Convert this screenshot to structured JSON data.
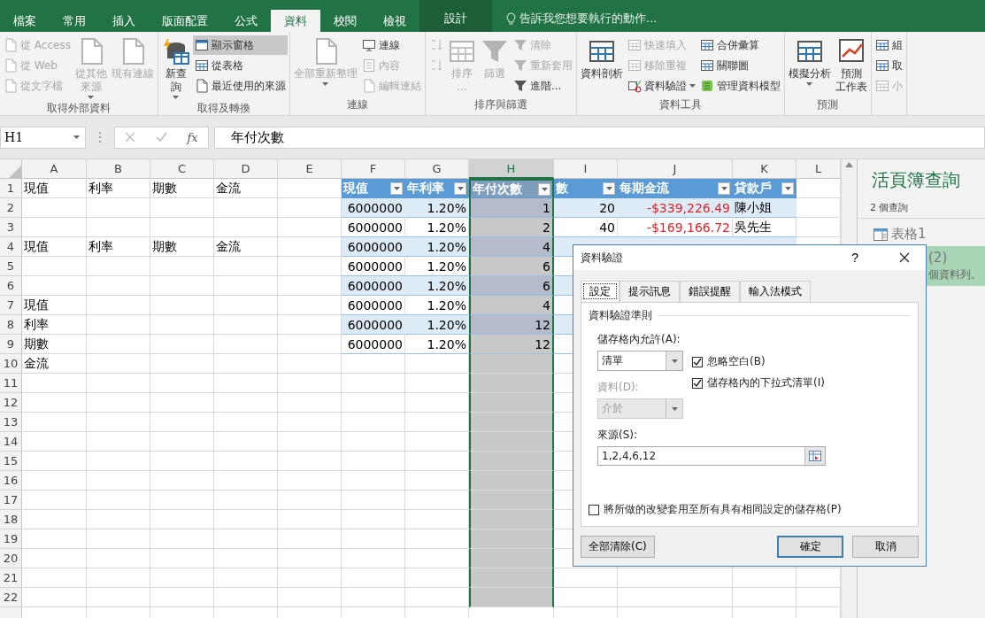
{
  "tabs": [
    {
      "label": "檔案",
      "kind": "file",
      "selected": false
    },
    {
      "label": "常用",
      "kind": "normal",
      "selected": false
    },
    {
      "label": "插入",
      "kind": "normal",
      "selected": false
    },
    {
      "label": "版面配置",
      "kind": "normal",
      "selected": false
    },
    {
      "label": "公式",
      "kind": "normal",
      "selected": false
    },
    {
      "label": "資料",
      "kind": "normal",
      "selected": true
    },
    {
      "label": "校閱",
      "kind": "normal",
      "selected": false
    },
    {
      "label": "檢視",
      "kind": "normal",
      "selected": false
    },
    {
      "label": "設計",
      "kind": "contextual",
      "selected": false
    }
  ],
  "tell_me": {
    "placeholder": "告訴我您想要執行的動作..."
  },
  "ribbon": [
    {
      "label": "取得外部資料",
      "columns": [
        {
          "kind": "stack",
          "items": [
            {
              "label": "從 Access",
              "disabled": true,
              "on": false
            },
            {
              "label": "從 Web",
              "disabled": true,
              "on": false
            },
            {
              "label": "從文字檔",
              "disabled": true,
              "on": false
            }
          ]
        },
        {
          "kind": "large",
          "lines": [
            "從其他",
            "來源"
          ],
          "disabled": true,
          "dropdown": true
        },
        {
          "kind": "large",
          "lines": [
            "現有連線"
          ],
          "disabled": true
        }
      ]
    },
    {
      "label": "取得及轉換",
      "columns": [
        {
          "kind": "large",
          "lines": [
            "新查",
            "詢"
          ],
          "disabled": false,
          "dropdown": true
        },
        {
          "kind": "stack",
          "items": [
            {
              "label": "顯示窗格",
              "disabled": false,
              "on": true
            },
            {
              "label": "從表格",
              "disabled": false,
              "on": false
            },
            {
              "label": "最近使用的來源",
              "disabled": false,
              "on": false
            }
          ]
        }
      ]
    },
    {
      "label": "連線",
      "columns": [
        {
          "kind": "large",
          "lines": [
            "全部重新整理"
          ],
          "disabled": true,
          "dropdown": true
        },
        {
          "kind": "stack",
          "items": [
            {
              "label": "連線",
              "disabled": false,
              "on": false
            },
            {
              "label": "內容",
              "disabled": true,
              "on": false
            },
            {
              "label": "編輯連結",
              "disabled": true,
              "on": false
            }
          ]
        }
      ]
    },
    {
      "label": "排序與篩選",
      "columns": [
        {
          "kind": "stack",
          "items": [
            {
              "disabled": true,
              "on": false
            },
            {
              "disabled": true,
              "on": false
            }
          ]
        },
        {
          "kind": "large",
          "lines": [
            "排序",
            "..."
          ],
          "disabled": true
        },
        {
          "kind": "large",
          "lines": [
            "篩選"
          ],
          "disabled": true
        },
        {
          "kind": "stack",
          "items": [
            {
              "label": "清除",
              "disabled": true,
              "on": false
            },
            {
              "label": "重新套用",
              "disabled": true,
              "on": false
            },
            {
              "label": "進階...",
              "disabled": false,
              "on": false
            }
          ]
        }
      ]
    },
    {
      "label": "資料工具",
      "columns": [
        {
          "kind": "large",
          "lines": [
            "資料剖析"
          ],
          "disabled": false
        },
        {
          "kind": "stack",
          "items": [
            {
              "label": "快速填入",
              "disabled": true,
              "on": false
            },
            {
              "label": "移除重複",
              "disabled": true,
              "on": false
            },
            {
              "label": "資料驗證",
              "disabled": false,
              "on": false,
              "dropdown": true
            }
          ]
        },
        {
          "kind": "stack",
          "items": [
            {
              "label": "合併彙算",
              "disabled": false,
              "on": false
            },
            {
              "label": "關聯圖",
              "disabled": false,
              "on": false
            },
            {
              "label": "管理資料模型",
              "disabled": false,
              "on": false
            }
          ]
        }
      ]
    },
    {
      "label": "預測",
      "columns": [
        {
          "kind": "large",
          "lines": [
            "模擬分析"
          ],
          "disabled": false,
          "dropdown": true
        },
        {
          "kind": "large",
          "lines": [
            "預測",
            "工作表"
          ],
          "disabled": false
        }
      ]
    },
    {
      "columns": [
        {
          "kind": "stack",
          "items": [
            {
              "label": "組",
              "disabled": false,
              "on": false
            },
            {
              "label": "取",
              "disabled": false,
              "on": false
            },
            {
              "label": "小",
              "disabled": true,
              "on": false
            }
          ]
        }
      ]
    }
  ],
  "formula_bar": {
    "name_box": "H1",
    "insert_function": "fx",
    "formula": "年付次數"
  },
  "columns": [
    {
      "label": "A",
      "selected": false
    },
    {
      "label": "B",
      "selected": false
    },
    {
      "label": "C",
      "selected": false
    },
    {
      "label": "D",
      "selected": false
    },
    {
      "label": "E",
      "selected": false
    },
    {
      "label": "F",
      "selected": false
    },
    {
      "label": "G",
      "selected": false
    },
    {
      "label": "H",
      "selected": true
    },
    {
      "label": "I",
      "selected": false
    },
    {
      "label": "J",
      "selected": false
    },
    {
      "label": "K",
      "selected": false
    },
    {
      "label": "L",
      "selected": false
    }
  ],
  "rows": [
    {
      "number": "1",
      "cells": [
        {
          "kind": "text",
          "text": "現值"
        },
        {
          "kind": "text",
          "text": "利率"
        },
        {
          "kind": "text",
          "text": "期數"
        },
        {
          "kind": "text",
          "text": "金流"
        },
        {
          "kind": "empty"
        },
        {
          "kind": "header",
          "text": "現值"
        },
        {
          "kind": "header",
          "text": "年利率"
        },
        {
          "kind": "header",
          "text": "年付次數"
        },
        {
          "kind": "header",
          "text": "數"
        },
        {
          "kind": "header",
          "text": "每期金流"
        },
        {
          "kind": "header",
          "text": "貸款戶"
        }
      ]
    },
    {
      "number": "2",
      "cells": [
        {
          "kind": "empty"
        },
        {
          "kind": "empty"
        },
        {
          "kind": "empty"
        },
        {
          "kind": "empty"
        },
        {
          "kind": "empty"
        },
        {
          "kind": "number",
          "text": "6000000",
          "shaded": true
        },
        {
          "kind": "number",
          "text": "1.20%",
          "shaded": true
        },
        {
          "kind": "number",
          "text": "1",
          "shaded": true
        },
        {
          "kind": "number",
          "text": "20",
          "shaded": true
        },
        {
          "kind": "negative",
          "text": "-$339,226.49",
          "shaded": true
        },
        {
          "kind": "text",
          "text": "陳小姐",
          "shaded": true
        }
      ]
    },
    {
      "number": "3",
      "cells": [
        {
          "kind": "empty"
        },
        {
          "kind": "empty"
        },
        {
          "kind": "empty"
        },
        {
          "kind": "empty"
        },
        {
          "kind": "empty"
        },
        {
          "kind": "number",
          "text": "6000000",
          "shaded": false
        },
        {
          "kind": "number",
          "text": "1.20%",
          "shaded": false
        },
        {
          "kind": "number",
          "text": "2",
          "shaded": false
        },
        {
          "kind": "number",
          "text": "40",
          "shaded": false
        },
        {
          "kind": "negative",
          "text": "-$169,166.72",
          "shaded": false
        },
        {
          "kind": "text",
          "text": "吳先生",
          "shaded": false
        }
      ]
    },
    {
      "number": "4",
      "cells": [
        {
          "kind": "text",
          "text": "現值"
        },
        {
          "kind": "text",
          "text": "利率"
        },
        {
          "kind": "text",
          "text": "期數"
        },
        {
          "kind": "text",
          "text": "金流"
        },
        {
          "kind": "empty"
        },
        {
          "kind": "number",
          "text": "6000000",
          "shaded": true
        },
        {
          "kind": "number",
          "text": "1.20%",
          "shaded": true
        },
        {
          "kind": "number",
          "text": "4",
          "shaded": true
        },
        {
          "kind": "empty",
          "shaded": true
        },
        {
          "kind": "empty",
          "shaded": true
        },
        {
          "kind": "empty",
          "shaded": true
        }
      ]
    },
    {
      "number": "5",
      "cells": [
        {
          "kind": "empty"
        },
        {
          "kind": "empty"
        },
        {
          "kind": "empty"
        },
        {
          "kind": "empty"
        },
        {
          "kind": "empty"
        },
        {
          "kind": "number",
          "text": "6000000",
          "shaded": false
        },
        {
          "kind": "number",
          "text": "1.20%",
          "shaded": false
        },
        {
          "kind": "number",
          "text": "6",
          "shaded": false
        },
        {
          "kind": "empty",
          "shaded": false
        }
      ]
    },
    {
      "number": "6",
      "cells": [
        {
          "kind": "empty"
        },
        {
          "kind": "empty"
        },
        {
          "kind": "empty"
        },
        {
          "kind": "empty"
        },
        {
          "kind": "empty"
        },
        {
          "kind": "number",
          "text": "6000000",
          "shaded": true
        },
        {
          "kind": "number",
          "text": "1.20%",
          "shaded": true
        },
        {
          "kind": "number",
          "text": "6",
          "shaded": true
        },
        {
          "kind": "empty",
          "shaded": true
        }
      ]
    },
    {
      "number": "7",
      "cells": [
        {
          "kind": "text",
          "text": "現值"
        },
        {
          "kind": "empty"
        },
        {
          "kind": "empty"
        },
        {
          "kind": "empty"
        },
        {
          "kind": "empty"
        },
        {
          "kind": "number",
          "text": "6000000",
          "shaded": false
        },
        {
          "kind": "number",
          "text": "1.20%",
          "shaded": false
        },
        {
          "kind": "number",
          "text": "4",
          "shaded": false
        },
        {
          "kind": "empty",
          "shaded": false
        }
      ]
    },
    {
      "number": "8",
      "cells": [
        {
          "kind": "text",
          "text": "利率"
        },
        {
          "kind": "empty"
        },
        {
          "kind": "empty"
        },
        {
          "kind": "empty"
        },
        {
          "kind": "empty"
        },
        {
          "kind": "number",
          "text": "6000000",
          "shaded": true
        },
        {
          "kind": "number",
          "text": "1.20%",
          "shaded": true
        },
        {
          "kind": "number",
          "text": "12",
          "shaded": true
        },
        {
          "kind": "empty",
          "shaded": true
        }
      ]
    },
    {
      "number": "9",
      "cells": [
        {
          "kind": "text",
          "text": "期數"
        },
        {
          "kind": "empty"
        },
        {
          "kind": "empty"
        },
        {
          "kind": "empty"
        },
        {
          "kind": "empty"
        },
        {
          "kind": "number",
          "text": "6000000",
          "shaded": false
        },
        {
          "kind": "number",
          "text": "1.20%",
          "shaded": false
        },
        {
          "kind": "number",
          "text": "12",
          "shaded": false
        },
        {
          "kind": "empty",
          "shaded": false
        }
      ]
    },
    {
      "number": "10",
      "cells": [
        {
          "kind": "text",
          "text": "金流"
        }
      ]
    },
    {
      "number": "11",
      "cells": []
    },
    {
      "number": "12",
      "cells": []
    },
    {
      "number": "13",
      "cells": []
    },
    {
      "number": "14",
      "cells": []
    },
    {
      "number": "15",
      "cells": []
    },
    {
      "number": "16",
      "cells": []
    },
    {
      "number": "17",
      "cells": []
    },
    {
      "number": "18",
      "cells": []
    },
    {
      "number": "19",
      "cells": []
    },
    {
      "number": "20",
      "cells": []
    },
    {
      "number": "21",
      "cells": []
    },
    {
      "number": "22",
      "cells": []
    }
  ],
  "query_pane": {
    "title": "活頁簿查詢",
    "count": "2 個查詢",
    "items": [
      {
        "kind": "query",
        "name": "表格1",
        "selected": false
      },
      {
        "kind": "query_partial",
        "name": "(2)",
        "detail": "個資料列。",
        "selected": true
      }
    ]
  },
  "dialog": {
    "title": "資料驗證",
    "help": "?",
    "tabs": [
      {
        "label": "設定",
        "selected": true
      },
      {
        "label": "提示訊息",
        "selected": false
      },
      {
        "label": "錯誤提醒",
        "selected": false
      },
      {
        "label": "輸入法模式",
        "selected": false
      }
    ],
    "section": "資料驗證準則",
    "allow_label": "儲存格內允許(A):",
    "allow_value": "清單",
    "ignore_blank": {
      "label": "忽略空白(B)",
      "checked": true
    },
    "in_cell_dropdown": {
      "label": "儲存格內的下拉式清單(I)",
      "checked": true
    },
    "data_label": "資料(D):",
    "data_value": "介於",
    "data_disabled": true,
    "source_label": "來源(S):",
    "source_value": "1,2,4,6,12",
    "apply_all": {
      "label": "將所做的改變套用至所有具有相同設定的儲存格(P)",
      "checked": false
    },
    "buttons": [
      {
        "label": "全部清除(C)",
        "kind": "left"
      },
      {
        "label": "確定",
        "kind": "default"
      },
      {
        "label": "取消",
        "kind": "normal"
      }
    ]
  }
}
